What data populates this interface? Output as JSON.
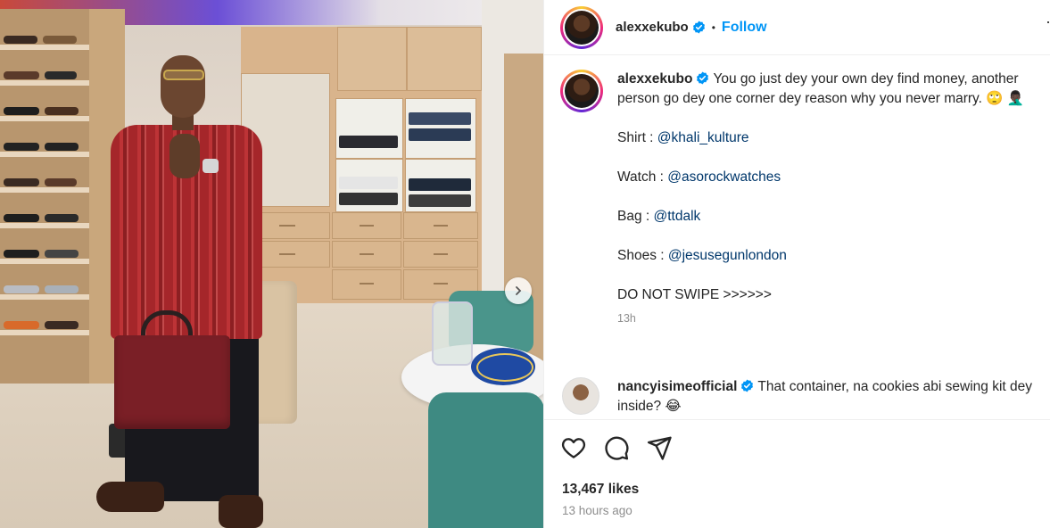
{
  "post": {
    "username": "alexxekubo",
    "follow_label": "Follow",
    "separator": "•",
    "more_label": "·"
  },
  "caption": {
    "username": "alexxekubo",
    "text": "You go just dey your own dey find money, another person go dey one corner dey reason why you never marry. 🙄 🤦🏿‍♂️",
    "lines": [
      {
        "label": "Shirt : ",
        "mention": "@khali_kulture"
      },
      {
        "label": "Watch : ",
        "mention": "@asorockwatches"
      },
      {
        "label": "Bag : ",
        "mention": "@ttdalk"
      },
      {
        "label": "Shoes : ",
        "mention": "@jesusegunlondon"
      }
    ],
    "closing": "DO NOT SWIPE >>>>>>",
    "time": "13h"
  },
  "comment": {
    "username": "nancyisimeofficial",
    "text": "That container, na cookies abi sewing kit dey inside? 😂"
  },
  "stats": {
    "likes": "13,467 likes",
    "posted": "13 hours ago"
  },
  "icons": {
    "like": "heart-icon",
    "comment": "comment-icon",
    "share": "share-icon",
    "next": "chevron-right-icon",
    "verified": "verified-badge-icon"
  },
  "colors": {
    "follow": "#0095f6",
    "mention": "#00376b",
    "verified": "#0095f6",
    "muted": "#8e8e8e"
  }
}
